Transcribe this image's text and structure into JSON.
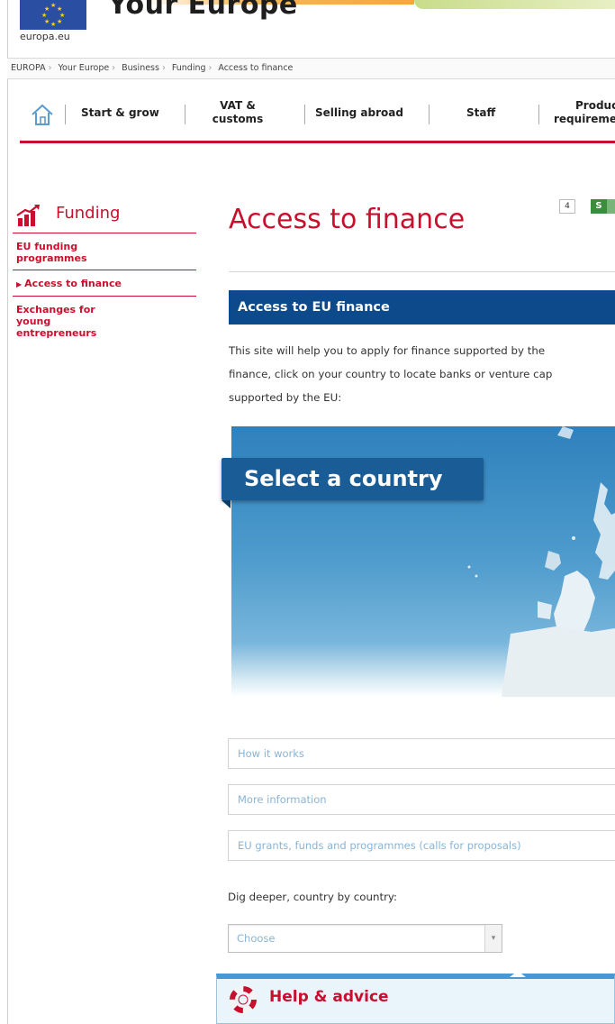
{
  "header": {
    "site_title": "Your Europe",
    "logo_text": "europa.eu"
  },
  "breadcrumb": [
    "EUROPA",
    "Your Europe",
    "Business",
    "Funding",
    "Access to finance"
  ],
  "nav": {
    "items": [
      {
        "label_line1": "Start & grow",
        "label_line2": ""
      },
      {
        "label_line1": "VAT &",
        "label_line2": "customs"
      },
      {
        "label_line1": "Selling abroad",
        "label_line2": ""
      },
      {
        "label_line1": "Staff",
        "label_line2": ""
      },
      {
        "label_line1": "Product",
        "label_line2": "requirements"
      }
    ],
    "accent_color": "#c8102e"
  },
  "page_tools": {
    "font_size_label": "4",
    "share_label": "S"
  },
  "sidebar": {
    "title": "Funding",
    "items": [
      {
        "label": "EU funding programmes",
        "active": false
      },
      {
        "label": "Access to finance",
        "active": true
      },
      {
        "label": "Exchanges for young entrepreneurs",
        "active": false
      }
    ]
  },
  "main": {
    "title": "Access to finance",
    "section_heading": "Access to EU finance",
    "intro_lines": [
      "This site will help you to apply for finance supported by the",
      "finance, click on your country to locate banks or venture cap",
      "supported by the EU:"
    ],
    "map_label": "Select a country",
    "accordion": [
      "How it works",
      "More information",
      "EU grants, funds and programmes (calls for proposals)"
    ],
    "dig_deeper": "Dig deeper, country by country:",
    "select": {
      "value": "Choose"
    },
    "help": {
      "title": "Help & advice"
    }
  },
  "colors": {
    "section_bar": "#0d4a8c",
    "map_ocean": "#4f9ccd",
    "link_light_blue": "#8ab4d4"
  }
}
